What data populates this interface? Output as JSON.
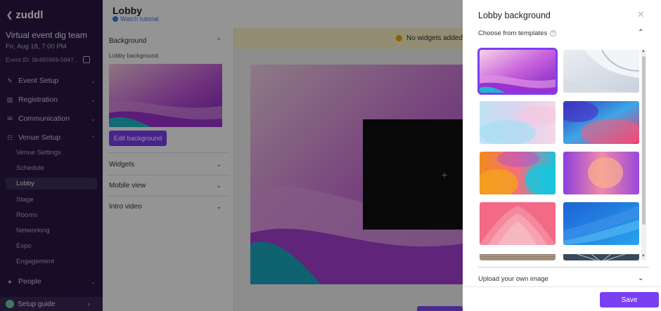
{
  "sidebar": {
    "logo": "zuddl",
    "event_title": "Virtual event dig team",
    "event_date": "Fri, Aug 18, 7:00 PM",
    "event_id": "Event ID: 0b485969-5847...",
    "sections": [
      {
        "label": "Event Setup",
        "icon": "wrench-icon"
      },
      {
        "label": "Registration",
        "icon": "id-card-icon"
      },
      {
        "label": "Communication",
        "icon": "mail-icon"
      },
      {
        "label": "Venue Setup",
        "icon": "venue-icon"
      }
    ],
    "venue_items": [
      "Venue Settings",
      "Schedule",
      "Lobby",
      "Stage",
      "Rooms",
      "Networking",
      "Expo",
      "Engagement"
    ],
    "people": {
      "label": "People",
      "icon": "people-icon"
    },
    "setup_guide": "Setup guide"
  },
  "main": {
    "title": "Lobby",
    "watch_tutorial": "Watch tutorial",
    "warning": "No widgets added",
    "panel": {
      "background_heading": "Background",
      "lobby_background_label": "Lobby background",
      "edit_background": "Edit background",
      "widgets": "Widgets",
      "mobile_view": "Mobile view",
      "intro_video": "Intro video"
    }
  },
  "drawer": {
    "title": "Lobby background",
    "choose_templates": "Choose from templates",
    "help_glyph": "?",
    "upload_own": "Upload your own image",
    "save": "Save",
    "selected_template_index": 0
  },
  "colors": {
    "sidebar_bg": "#281842",
    "accent": "#7b3ff2",
    "warning_bg": "#fdf3c7",
    "warning_icon": "#f0a800"
  }
}
